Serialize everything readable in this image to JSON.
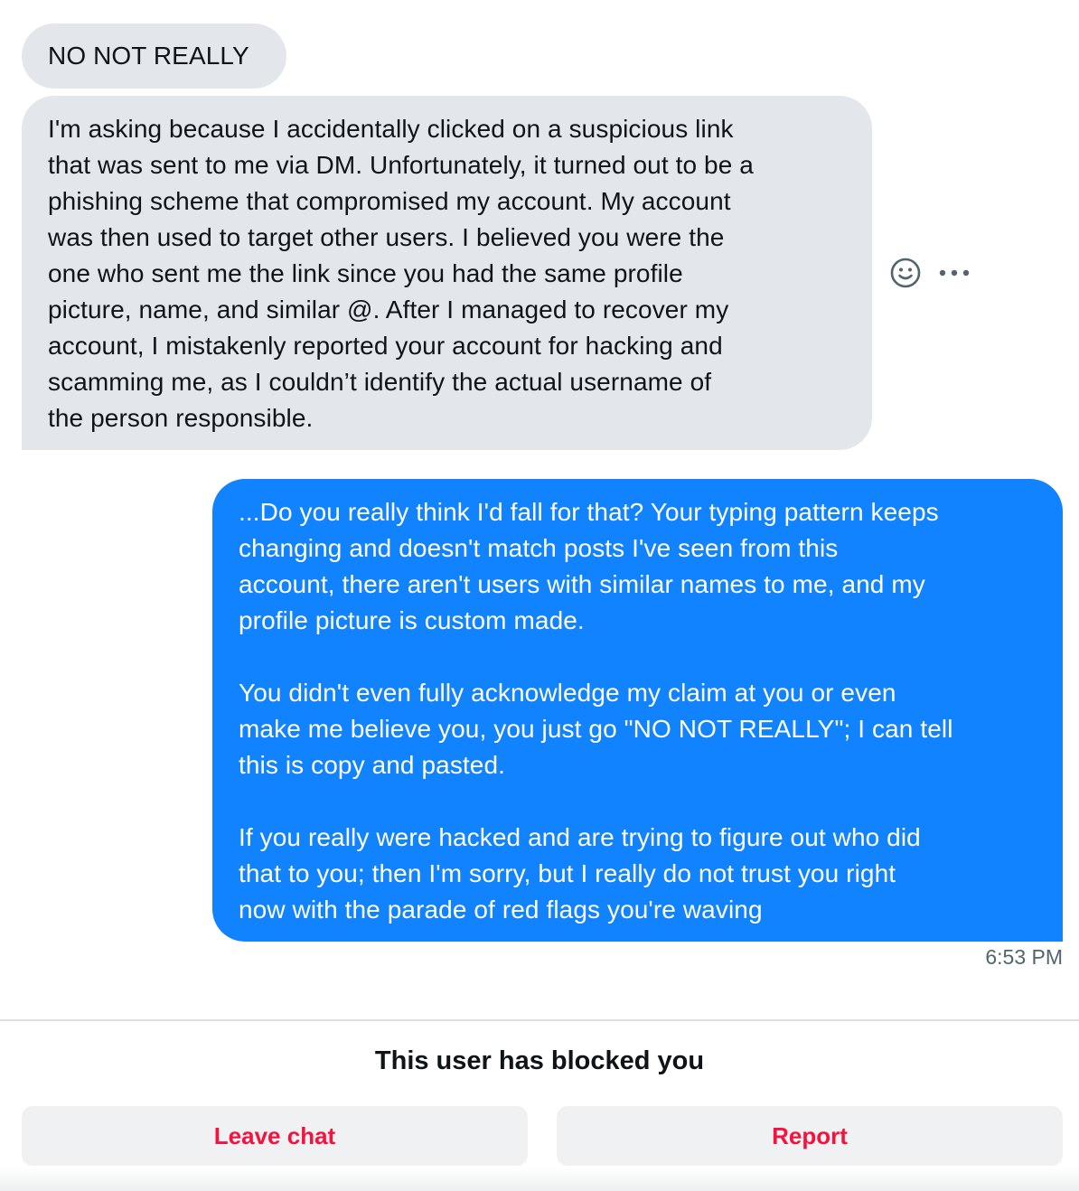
{
  "messages": [
    {
      "direction": "incoming",
      "text": "NO NOT REALLY"
    },
    {
      "direction": "incoming",
      "text": "I'm asking because I accidentally clicked on a suspicious link\nthat was sent to me via DM. Unfortunately, it turned out to be a\nphishing scheme that compromised my account. My account\nwas then used to target other users. I believed you were the\none who sent me the link since you had the same profile\npicture, name, and similar @. After I managed to recover my\naccount, I mistakenly reported your account for hacking and\nscamming me, as I couldn’t identify the actual username of\nthe person responsible."
    },
    {
      "direction": "outgoing",
      "text": "...Do you really think I'd fall for that? Your typing pattern keeps\nchanging and doesn't match posts I've seen from this\naccount, there aren't users with similar names to me, and my\nprofile picture is custom made.\n\nYou didn't even fully acknowledge my claim at you or even\nmake me believe you, you just go \"NO NOT REALLY\"; I can tell\nthis is copy and pasted.\n\nIf you really were hacked and are trying to figure out who did\nthat to you; then I'm sorry, but I really do not trust you right\nnow with the parade of red flags you're waving",
      "timestamp": "6:53 PM"
    }
  ],
  "message_actions": {
    "react_icon": "smiley-face-icon",
    "more_icon": "more-horizontal-icon"
  },
  "footer": {
    "blocked_notice": "This user has blocked you",
    "leave_label": "Leave chat",
    "report_label": "Report"
  },
  "colors": {
    "incoming_bubble": "#e3e7eb",
    "outgoing_bubble": "#1183fe",
    "danger_text": "#f4123f",
    "secondary_text": "#536471"
  }
}
